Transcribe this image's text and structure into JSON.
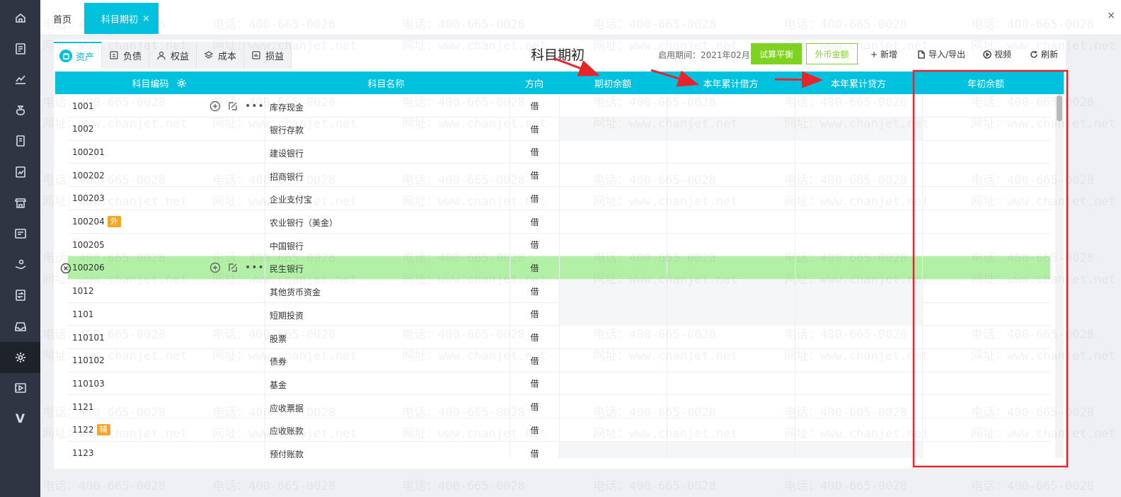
{
  "sidebar": {
    "items": [
      {
        "name": "home-icon"
      },
      {
        "name": "voucher-icon"
      },
      {
        "name": "chart-icon"
      },
      {
        "name": "money-bag-icon"
      },
      {
        "name": "book-icon"
      },
      {
        "name": "report-icon"
      },
      {
        "name": "store-icon"
      },
      {
        "name": "invoice-icon"
      },
      {
        "name": "hand-coin-icon"
      },
      {
        "name": "transfer-icon"
      },
      {
        "name": "inbox-icon"
      },
      {
        "name": "gear-icon",
        "active": true
      },
      {
        "name": "video-icon"
      },
      {
        "name": "v-logo-icon"
      }
    ],
    "v_glyph": "V"
  },
  "tabs": {
    "home": "首页",
    "active": "科目期初",
    "close": "×",
    "edge_close": "×"
  },
  "categories": [
    {
      "label": "资产",
      "icon": "asset-icon",
      "active": true
    },
    {
      "label": "负债",
      "icon": "liability-icon"
    },
    {
      "label": "权益",
      "icon": "equity-icon"
    },
    {
      "label": "成本",
      "icon": "cost-icon"
    },
    {
      "label": "损益",
      "icon": "profit-loss-icon"
    }
  ],
  "toolbar": {
    "title": "科目期初",
    "enable_period": "启用期间：2021年02月",
    "trial_balance": "试算平衡",
    "fx_amount": "外币金额",
    "add": "+ 新增",
    "import_export": "导入/导出",
    "video": "视频",
    "refresh": "刷新"
  },
  "table": {
    "headers": {
      "code": "科目编码",
      "name": "科目名称",
      "direction": "方向",
      "opening": "期初余额",
      "ytd_debit": "本年累计借方",
      "ytd_credit": "本年累计贷方",
      "year_begin": "年初余额"
    },
    "rows": [
      {
        "code": "1001",
        "name": "库存现金",
        "dir": "借",
        "actions": true,
        "shade": false
      },
      {
        "code": "1002",
        "name": "银行存款",
        "dir": "借",
        "shade": true
      },
      {
        "code": "100201",
        "name": "建设银行",
        "dir": "借"
      },
      {
        "code": "100202",
        "name": "招商银行",
        "dir": "借"
      },
      {
        "code": "100203",
        "name": "企业支付宝",
        "dir": "借"
      },
      {
        "code": "100204",
        "name": "农业银行（美金）",
        "dir": "借",
        "badge": "外"
      },
      {
        "code": "100205",
        "name": "中国银行",
        "dir": "借"
      },
      {
        "code": "100206",
        "name": "民生银行",
        "dir": "借",
        "highlight": true,
        "actions": true
      },
      {
        "code": "1012",
        "name": "其他货币资金",
        "dir": "借",
        "shade": true
      },
      {
        "code": "1101",
        "name": "短期投资",
        "dir": "借",
        "shade": true
      },
      {
        "code": "110101",
        "name": "股票",
        "dir": "借"
      },
      {
        "code": "110102",
        "name": "债券",
        "dir": "借"
      },
      {
        "code": "110103",
        "name": "基金",
        "dir": "借"
      },
      {
        "code": "1121",
        "name": "应收票据",
        "dir": "借"
      },
      {
        "code": "1122",
        "name": "应收账款",
        "dir": "借",
        "badge": "辅"
      },
      {
        "code": "1123",
        "name": "预付账款",
        "dir": "借",
        "shade": true
      }
    ]
  },
  "watermark": {
    "phone": "电话：400-665-0028",
    "site": "网址：www.chanjet.net"
  },
  "colors": {
    "accent": "#00c1de",
    "highlight_row": "#b1f0a5",
    "green_button": "#7ed321",
    "annotation": "#e8242a",
    "badge": "#f5a623"
  }
}
